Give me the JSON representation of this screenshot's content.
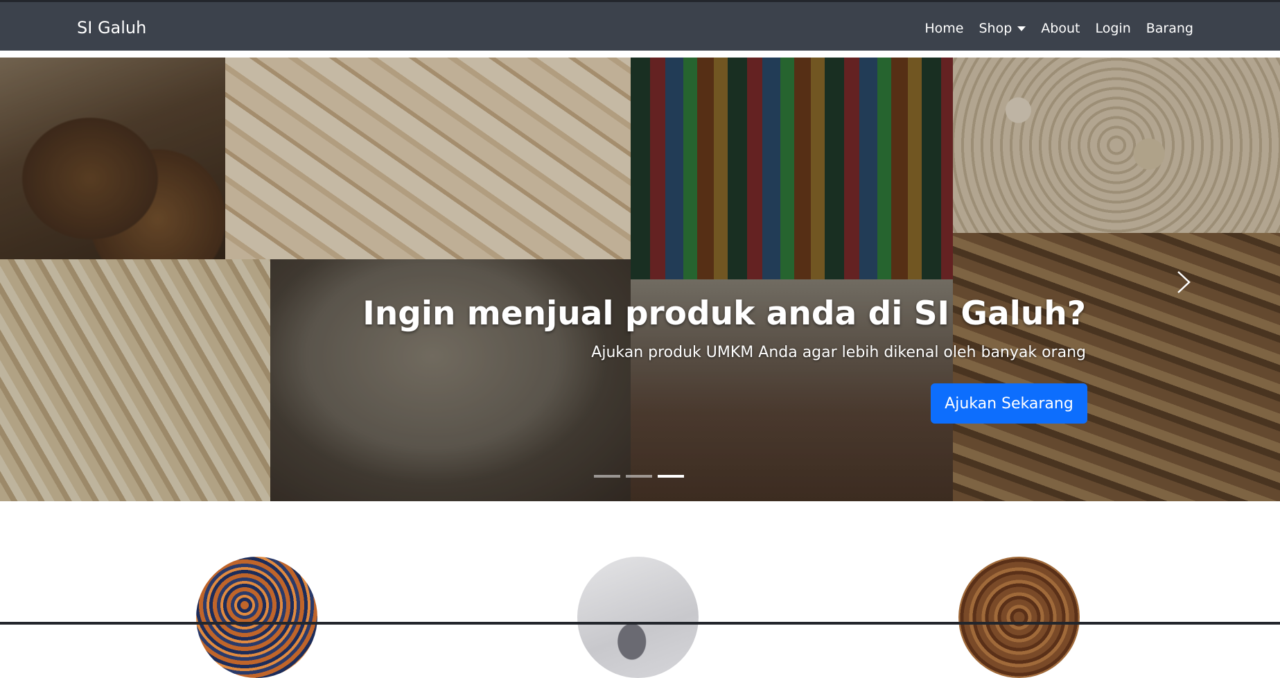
{
  "navbar": {
    "brand": "SI Galuh",
    "items": [
      {
        "label": "Home"
      },
      {
        "label": "Shop"
      },
      {
        "label": "About"
      },
      {
        "label": "Login"
      },
      {
        "label": "Barang"
      }
    ]
  },
  "hero": {
    "title": "Ingin menjual produk anda di SI Galuh?",
    "subtitle": "Ajukan produk UMKM Anda agar lebih dikenal oleh banyak orang",
    "cta_label": "Ajukan Sekarang",
    "slide_count": 3,
    "active_slide": 3
  },
  "colors": {
    "navbar_bg": "#3c424c",
    "cta_bg": "#0d6efd"
  },
  "icons": {
    "next": "chevron-right-icon",
    "dropdown": "caret-down-icon"
  }
}
